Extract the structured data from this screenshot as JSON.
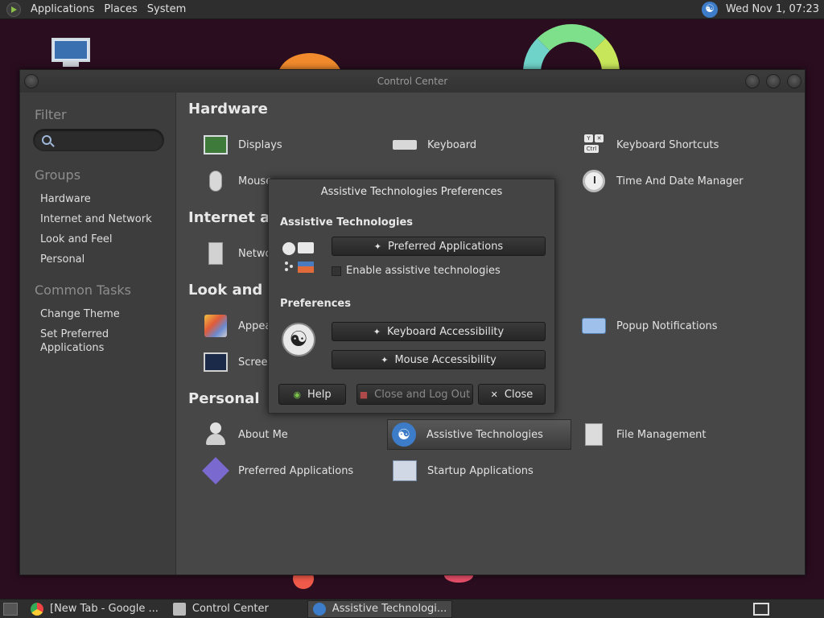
{
  "top_panel": {
    "menus": [
      "Applications",
      "Places",
      "System"
    ],
    "clock": "Wed Nov 1, 07:23"
  },
  "window": {
    "title": "Control Center"
  },
  "sidebar": {
    "filter_heading": "Filter",
    "search_placeholder": "",
    "groups_heading": "Groups",
    "groups": [
      "Hardware",
      "Internet and Network",
      "Look and Feel",
      "Personal"
    ],
    "tasks_heading": "Common Tasks",
    "tasks": [
      "Change Theme",
      "Set Preferred Applications"
    ]
  },
  "sections": {
    "hardware": {
      "title": "Hardware",
      "items": [
        "Displays",
        "Keyboard",
        "Keyboard Shortcuts",
        "Mouse",
        "Time And Date Manager"
      ]
    },
    "internet": {
      "title": "Internet and Network",
      "items": [
        "Network"
      ]
    },
    "look": {
      "title": "Look and Feel",
      "items": [
        "Appearance",
        "Popup Notifications",
        "Screensaver"
      ]
    },
    "personal": {
      "title": "Personal",
      "items": [
        "About Me",
        "Assistive Technologies",
        "File Management",
        "Preferred Applications",
        "Startup Applications"
      ]
    }
  },
  "dialog": {
    "title": "Assistive Technologies Preferences",
    "section1": "Assistive Technologies",
    "preferred_apps_btn": "Preferred Applications",
    "enable_checkbox": "Enable assistive technologies",
    "enable_checked": false,
    "section2": "Preferences",
    "keyboard_btn": "Keyboard Accessibility",
    "mouse_btn": "Mouse Accessibility",
    "help_btn": "Help",
    "logout_btn": "Close and Log Out",
    "close_btn": "Close"
  },
  "taskbar": {
    "tasks": [
      "[New Tab - Google ...",
      "Control Center",
      "Assistive Technologi..."
    ],
    "active_index": 2
  }
}
